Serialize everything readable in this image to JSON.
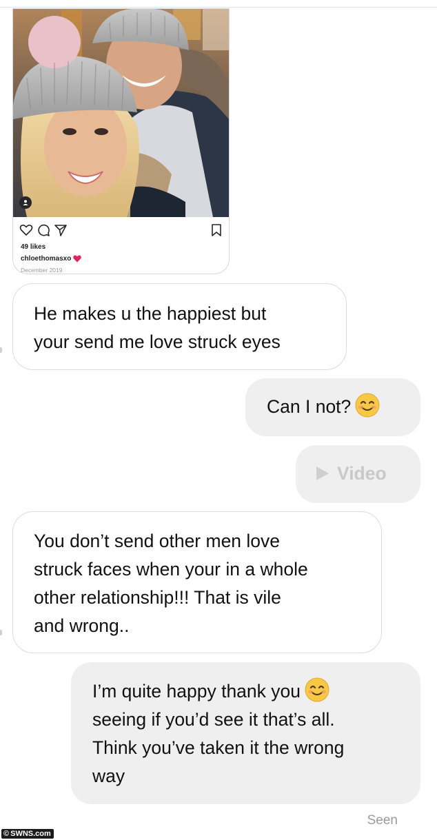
{
  "post": {
    "likes": "49 likes",
    "username": "chloethomasxo",
    "date": "December 2019",
    "photo_icon": "selfie-photo-couple-winter-hats",
    "action_icons": [
      "heart-icon",
      "comment-icon",
      "share-icon",
      "bookmark-icon"
    ]
  },
  "messages": [
    {
      "from": "them",
      "lines": [
        "He makes u the happiest but",
        "your send me love struck eyes"
      ]
    },
    {
      "from": "me",
      "text": "Can I not?",
      "emoji": "smiling-face-emoji"
    },
    {
      "from": "me",
      "text": "Video",
      "icon": "play-icon"
    },
    {
      "from": "them",
      "lines": [
        "You don’t send other men love",
        "struck faces when your in a whole",
        "other relationship!!! That is vile",
        "and wrong.."
      ]
    },
    {
      "from": "me",
      "lines": [
        "I’m quite happy thank you",
        "seeing if you’d see it that’s all.",
        "Think you’ve taken it the wrong",
        "way"
      ],
      "emoji": "smiling-face-emoji"
    }
  ],
  "status": {
    "seen": "Seen"
  },
  "watermark": "SWNS.com",
  "colors": {
    "incoming_bubble": "#ffffff",
    "incoming_border": "#dcdcdc",
    "outgoing_bubble": "#efefef",
    "video_text": "#c9c9c9",
    "heart_emoji": "#e0245e",
    "emoji_yellow": "#f7c843"
  }
}
